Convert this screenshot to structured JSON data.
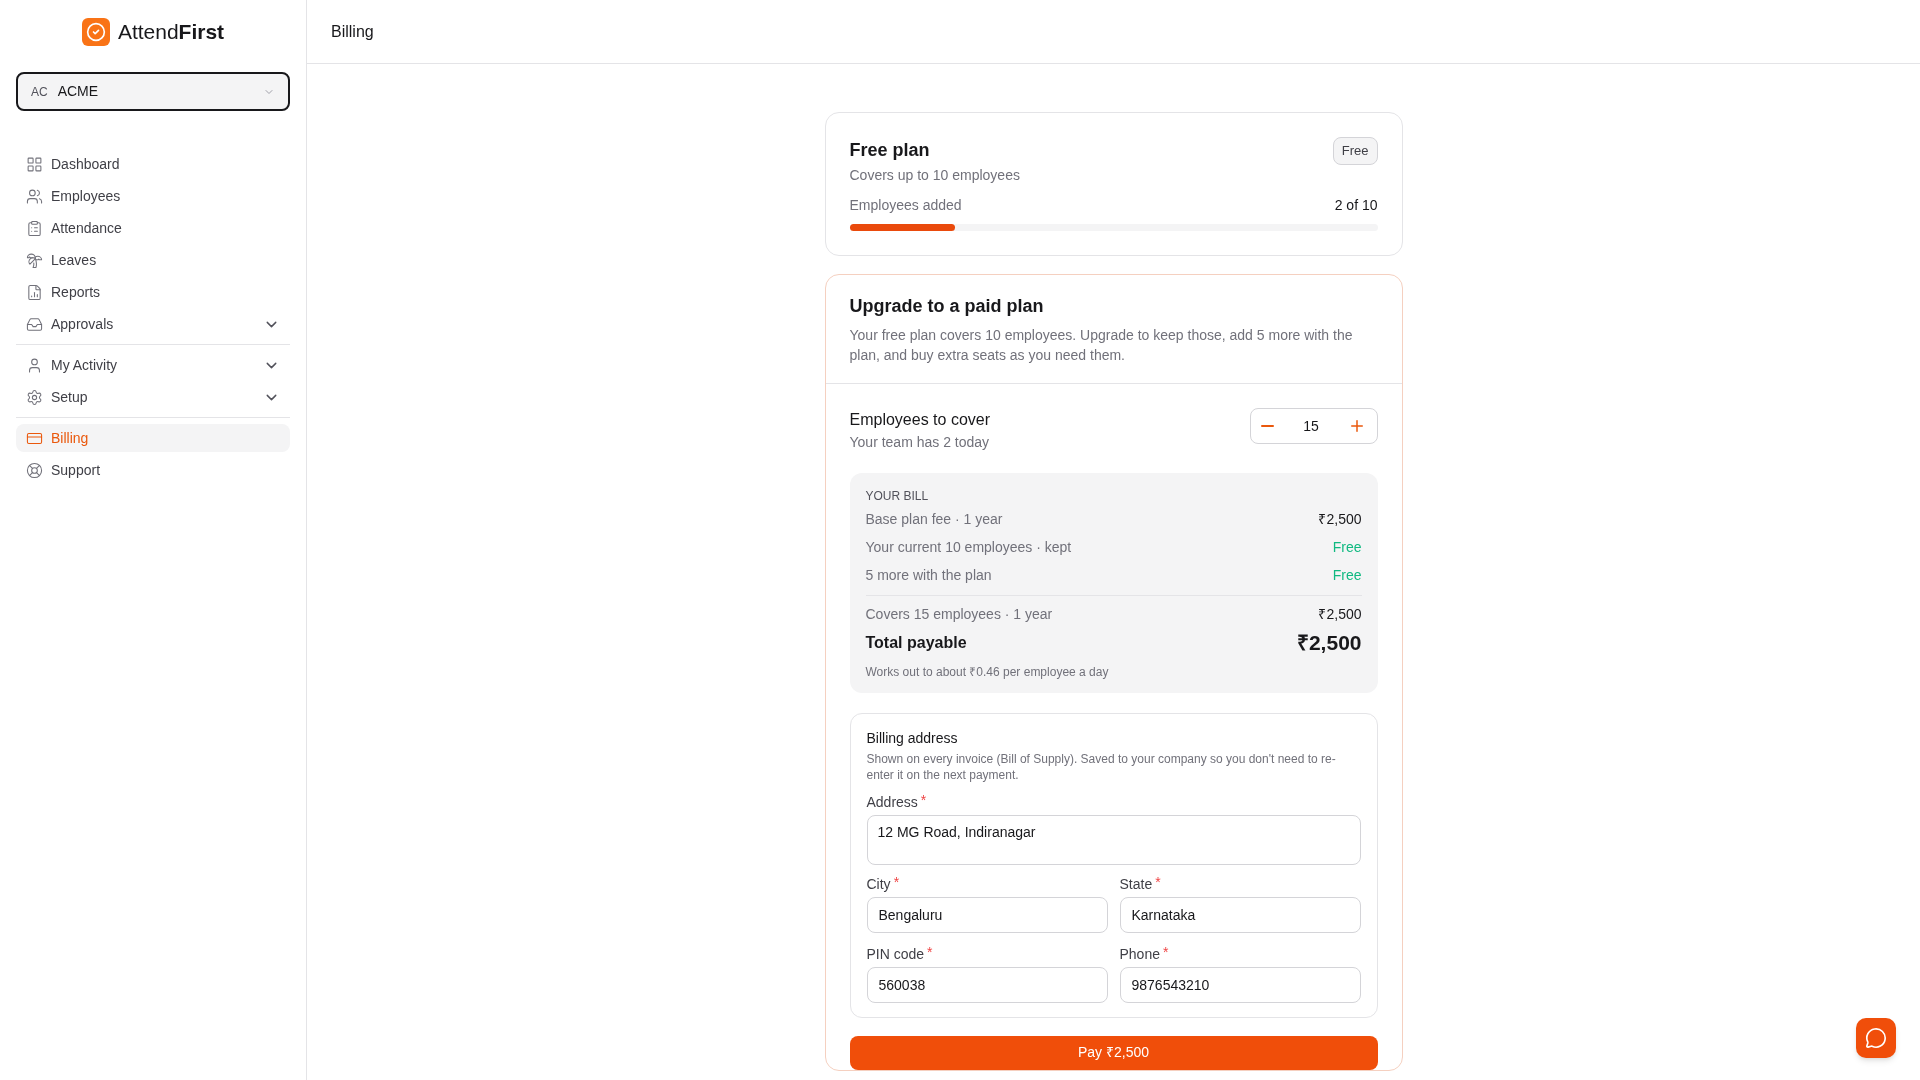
{
  "brand": {
    "name_plain": "Attend",
    "name_bold": "First"
  },
  "org_select": {
    "initials": "AC",
    "name": "ACME"
  },
  "sidebar": {
    "groups": [
      {
        "items": [
          {
            "label": "Dashboard",
            "selected": false
          },
          {
            "label": "Employees",
            "selected": false
          },
          {
            "label": "Attendance",
            "selected": false
          },
          {
            "label": "Leaves",
            "selected": false
          },
          {
            "label": "Reports",
            "selected": false
          },
          {
            "label": "Approvals",
            "selected": false,
            "expanded": false
          }
        ]
      },
      {
        "items": [
          {
            "label": "My Activity",
            "selected": false,
            "expanded": false
          },
          {
            "label": "Setup",
            "selected": false,
            "expanded": false
          }
        ]
      },
      {
        "items": [
          {
            "label": "Billing",
            "selected": true
          },
          {
            "label": "Support",
            "selected": false
          }
        ]
      }
    ]
  },
  "header": {
    "title": "Billing"
  },
  "free_plan": {
    "title": "Free plan",
    "subtitle": "Covers up to 10 employees",
    "badge": "Free",
    "usage_label": "Employees added",
    "usage_value": "2 of 10",
    "level": 0.2
  },
  "upgrade": {
    "title": "Upgrade to a paid plan",
    "description": "Your free plan covers 10 employees. Upgrade to keep those, add 5 more with the plan, and buy extra seats as you need them.",
    "cover_title": "Employees to cover",
    "cover_subtitle": "Your team has 2 today",
    "count": "15",
    "bill": {
      "heading": "YOUR BILL",
      "lines": [
        {
          "label": "Base plan fee · 1 year",
          "amount": "₹2,500",
          "kind": "charge"
        },
        {
          "label": "Your current 10 employees · kept",
          "amount": "Free",
          "kind": "free"
        },
        {
          "label": "5 more with the plan",
          "amount": "Free",
          "kind": "free"
        }
      ],
      "summary_label": "Covers 15 employees · 1 year",
      "summary_amount": "₹2,500",
      "total_label": "Total payable",
      "total_amount": "₹2,500",
      "note": "Works out to about ₹0.46 per employee a day"
    },
    "address": {
      "title": "Billing address",
      "description": "Shown on every invoice (Bill of Supply). Saved to your company so you don't need to re-enter it on the next payment.",
      "fields": [
        {
          "label": "Address",
          "value": "12 MG Road, Indiranagar",
          "required_mark": "*",
          "kind": "textarea"
        },
        {
          "label": "City",
          "value": "Bengaluru",
          "required_mark": "*",
          "kind": "input"
        },
        {
          "label": "State",
          "value": "Karnataka",
          "required_mark": "*",
          "kind": "input"
        },
        {
          "label": "PIN code",
          "value": "560038",
          "required_mark": "*",
          "kind": "input"
        },
        {
          "label": "Phone",
          "value": "9876543210",
          "required_mark": "*",
          "kind": "input"
        }
      ]
    },
    "pay_button": "Pay ₹2,500"
  }
}
